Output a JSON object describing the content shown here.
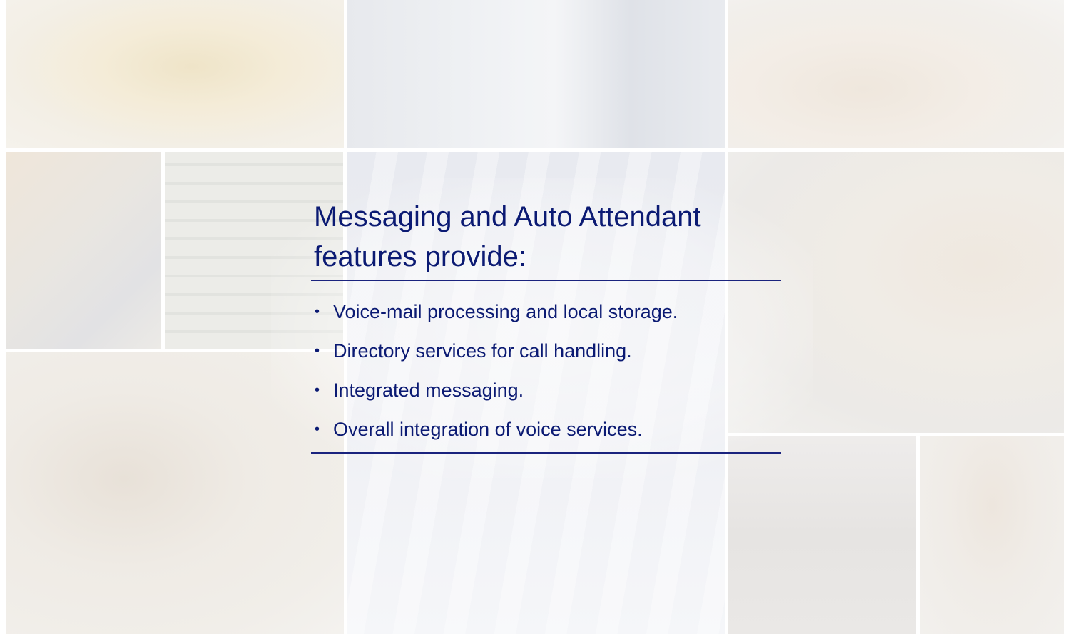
{
  "slide": {
    "title_line1": "Messaging and Auto Attendant",
    "title_line2": "features provide:",
    "bullets": [
      "Voice-mail processing and local storage.",
      "Directory services for call handling.",
      "Integrated messaging.",
      "Overall integration of voice services."
    ],
    "colors": {
      "text": "#0b1a73",
      "rule": "#1a237e",
      "background": "#ffffff"
    }
  }
}
